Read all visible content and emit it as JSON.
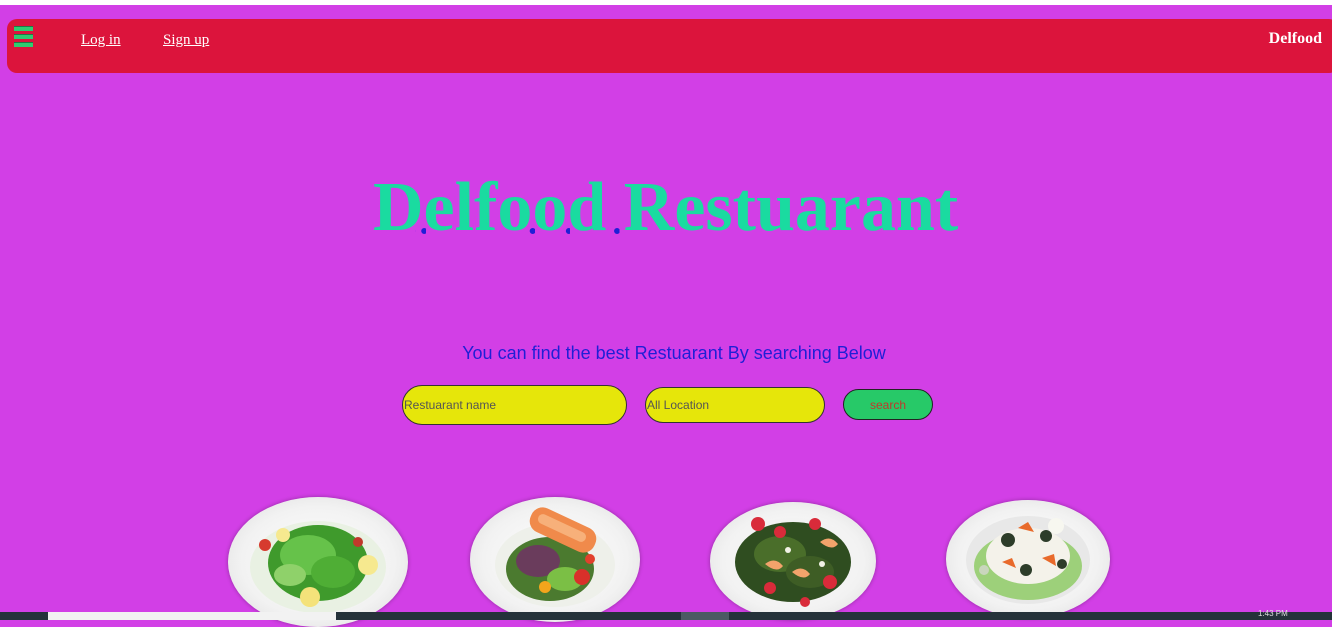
{
  "navbar": {
    "menu_icon": "hamburger-menu-icon",
    "login_label": "Log in",
    "signup_label": "Sign up",
    "brand": "Delfood"
  },
  "hero": {
    "title": "Delfood Restuarant",
    "subtitle": "You can find the best Restuarant By searching Below"
  },
  "search": {
    "name_placeholder": "Restuarant name",
    "location_placeholder": "All Location",
    "button_label": "search"
  },
  "dishes": [
    {
      "name": "green-salad-plate"
    },
    {
      "name": "salmon-salad-plate"
    },
    {
      "name": "strawberry-shrimp-salad-plate"
    },
    {
      "name": "mixed-salad-plate"
    }
  ],
  "taskbar": {
    "clock": "1:43 PM"
  },
  "colors": {
    "background": "#d23fe6",
    "navbar": "#dc143c",
    "title": "#1adba0",
    "subtitle": "#1f1fd6",
    "input": "#e6e60a",
    "button": "#27c968"
  }
}
